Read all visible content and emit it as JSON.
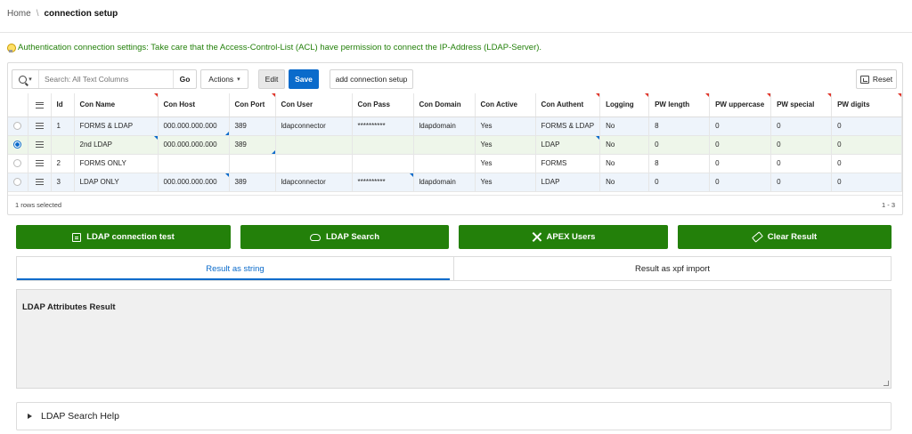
{
  "breadcrumb": {
    "home": "Home",
    "separator": "\\",
    "current": "connection setup"
  },
  "info": {
    "text": "Authentication connection settings: Take care that the Access-Control-List (ACL) have permission to connect the IP-Address (LDAP-Server)."
  },
  "toolbar": {
    "search_placeholder": "Search: All Text Columns",
    "go_label": "Go",
    "actions_label": "Actions",
    "edit_label": "Edit",
    "save_label": "Save",
    "add_label": "add connection setup",
    "reset_label": "Reset"
  },
  "grid": {
    "columns": [
      "Id",
      "Con Name",
      "Con Host",
      "Con Port",
      "Con User",
      "Con Pass",
      "Con Domain",
      "Con Active",
      "Con Authent",
      "Logging",
      "PW length",
      "PW uppercase",
      "PW special",
      "PW digits"
    ],
    "rows": [
      {
        "selected": false,
        "cells": [
          "1",
          "FORMS & LDAP",
          "000.000.000.000",
          "389",
          "ldapconnector",
          "**********",
          "ldapdomain",
          "Yes",
          "FORMS & LDAP",
          "No",
          "8",
          "0",
          "0",
          "0"
        ]
      },
      {
        "selected": true,
        "cells": [
          "",
          "2nd LDAP",
          "000.000.000.000",
          "389",
          "",
          "",
          "",
          "Yes",
          "LDAP",
          "No",
          "0",
          "0",
          "0",
          "0"
        ]
      },
      {
        "selected": false,
        "cells": [
          "2",
          "FORMS ONLY",
          "",
          "",
          "",
          "",
          "",
          "Yes",
          "FORMS",
          "No",
          "8",
          "0",
          "0",
          "0"
        ]
      },
      {
        "selected": false,
        "cells": [
          "3",
          "LDAP ONLY",
          "000.000.000.000",
          "389",
          "ldapconnector",
          "**********",
          "ldapdomain",
          "Yes",
          "LDAP",
          "No",
          "0",
          "0",
          "0",
          "0"
        ]
      }
    ],
    "footer_selected": "1 rows selected",
    "footer_range": "1 - 3"
  },
  "actions": {
    "ldap_test": "LDAP connection test",
    "ldap_search": "LDAP Search",
    "apex_users": "APEX Users",
    "clear_result": "Clear Result"
  },
  "tabs": {
    "string": "Result as string",
    "xpf": "Result as xpf import"
  },
  "result": {
    "title": "LDAP Attributes Result"
  },
  "help": {
    "title": "LDAP Search Help"
  },
  "colors": {
    "accent_green": "#23800a",
    "accent_blue": "#0b6bcb"
  },
  "icons": [
    "bulb-icon",
    "search-icon",
    "chevron-down-icon",
    "reset-icon",
    "drag-handle-icon",
    "document-icon",
    "cloud-icon",
    "tools-icon",
    "eraser-icon",
    "caret-right-icon"
  ]
}
